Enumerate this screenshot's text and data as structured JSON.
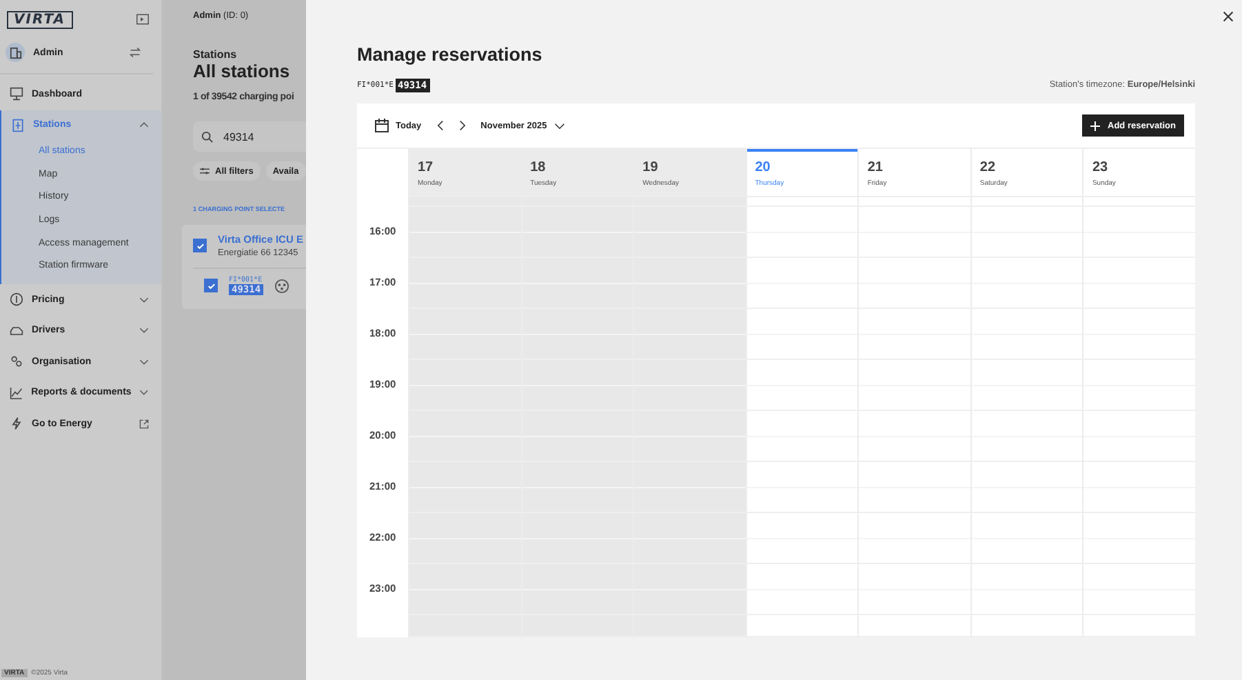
{
  "sidebar": {
    "logo": "VIRTA",
    "account": {
      "name": "Admin"
    },
    "items": [
      {
        "kind": "link",
        "label": "Dashboard"
      },
      {
        "kind": "group",
        "label": "Stations",
        "selected": true,
        "expanded": true,
        "children": [
          {
            "label": "All stations",
            "selected": true
          },
          {
            "label": "Map",
            "selected": false
          },
          {
            "label": "History",
            "selected": false
          },
          {
            "label": "Logs",
            "selected": false
          },
          {
            "label": "Access management",
            "selected": false
          },
          {
            "label": "Station firmware",
            "selected": false
          }
        ]
      },
      {
        "kind": "group",
        "label": "Pricing",
        "selected": false,
        "expanded": false
      },
      {
        "kind": "group",
        "label": "Drivers",
        "selected": false,
        "expanded": false
      },
      {
        "kind": "group",
        "label": "Organisation",
        "selected": false,
        "expanded": false
      },
      {
        "kind": "group",
        "label": "Reports & documents",
        "selected": false,
        "expanded": false
      },
      {
        "kind": "external",
        "label": "Go to Energy"
      }
    ],
    "footer": {
      "logo": "VIRTA",
      "text": "©2025 Virta"
    }
  },
  "page": {
    "user": "**Admin** (ID: 0)",
    "breadcrumb": "Stations",
    "title": "All stations",
    "count": "1 of 39542 charging poi",
    "search": {
      "value": "49314"
    },
    "filters": [
      "All filters",
      "Availa"
    ],
    "selection": "1 CHARGING POINT SELECTE",
    "station": {
      "checked": true,
      "name": "Virta Office ICU E",
      "address": "Energiatie 66 12345",
      "connector": {
        "checked": true,
        "prefix": "FI*001*E",
        "id": "49314"
      }
    }
  },
  "modal": {
    "title": "Manage reservations",
    "station_prefix": "FI*001*E",
    "station_id": "49314",
    "timezone": "Station's timezone: **Europe/Helsinki**",
    "toolbar": {
      "today": "Today",
      "month": "November 2025",
      "add_button": "Add reservation"
    },
    "days": [
      {
        "date": "17",
        "weekday": "Monday",
        "past": true,
        "selected": false
      },
      {
        "date": "18",
        "weekday": "Tuesday",
        "past": true,
        "selected": false
      },
      {
        "date": "19",
        "weekday": "Wednesday",
        "past": true,
        "selected": false
      },
      {
        "date": "20",
        "weekday": "Thursday",
        "past": false,
        "selected": true
      },
      {
        "date": "21",
        "weekday": "Friday",
        "past": false,
        "selected": false
      },
      {
        "date": "22",
        "weekday": "Saturday",
        "past": false,
        "selected": false
      },
      {
        "date": "23",
        "weekday": "Sunday",
        "past": false,
        "selected": false
      }
    ],
    "hours": [
      "16:00",
      "17:00",
      "18:00",
      "19:00",
      "20:00",
      "21:00",
      "22:00",
      "23:00"
    ]
  }
}
